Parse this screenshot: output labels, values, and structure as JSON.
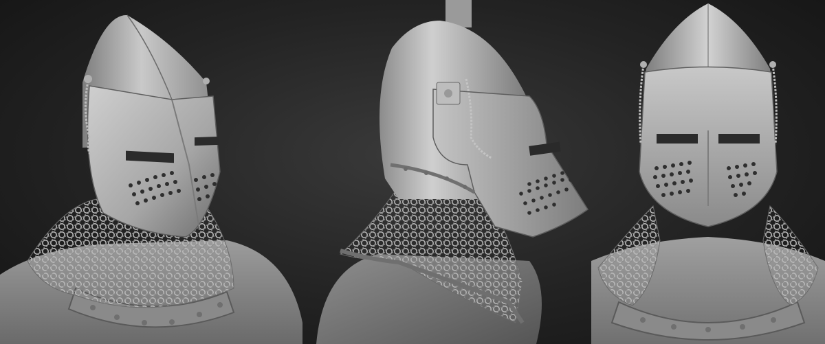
{
  "scene": {
    "background_color": "#1c1c1c",
    "material_color": "#9a9a9a",
    "highlight_color": "#d6d6d6",
    "shadow_color": "#3a3a3a",
    "views": [
      {
        "id": "three-quarter",
        "subject": "bascinet-helmet-knight"
      },
      {
        "id": "profile",
        "subject": "bascinet-helmet-knight"
      },
      {
        "id": "front",
        "subject": "bascinet-helmet-knight"
      }
    ]
  }
}
